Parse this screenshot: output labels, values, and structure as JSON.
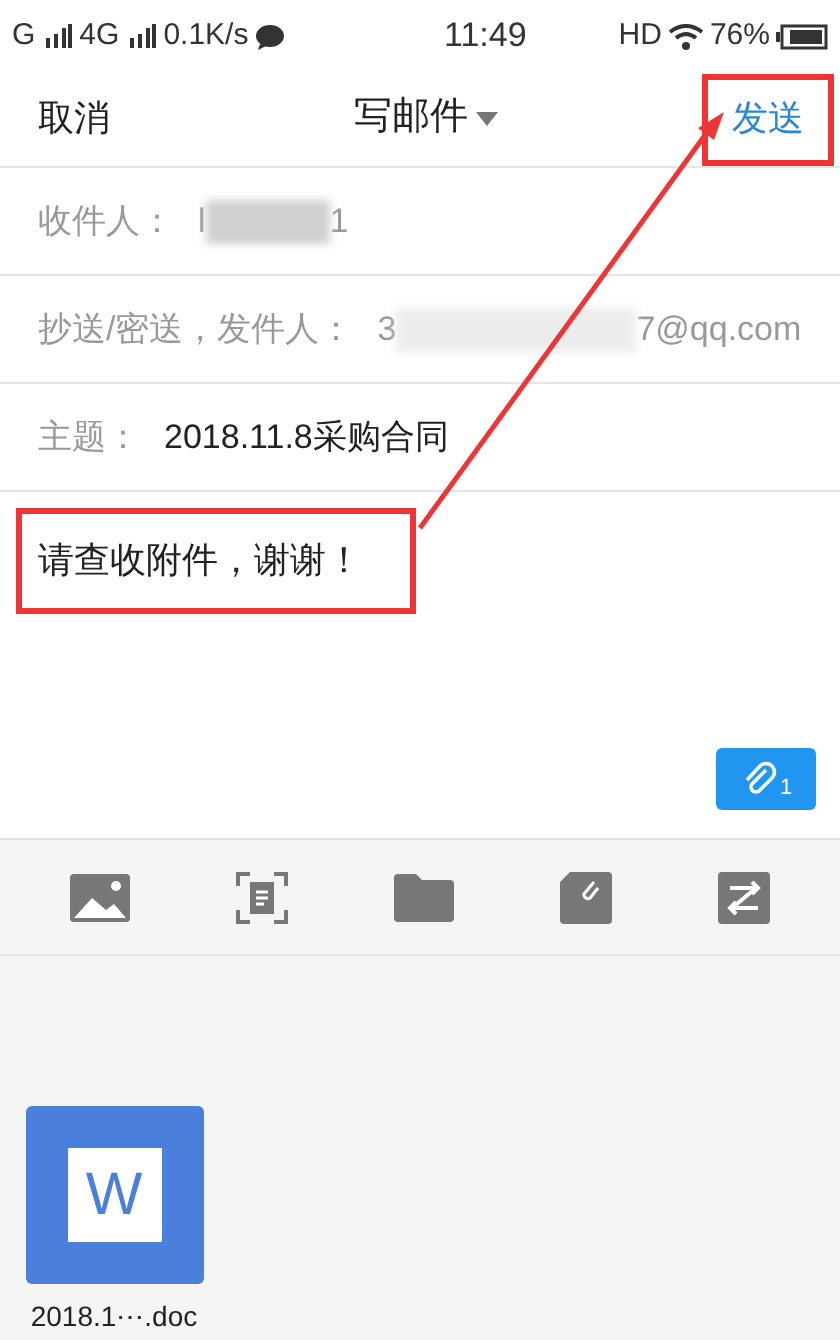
{
  "status_bar": {
    "left": [
      "G",
      "4G",
      "0.1K/s"
    ],
    "time": "11:49",
    "hd": "HD",
    "battery": "76%"
  },
  "header": {
    "cancel": "取消",
    "title": "写邮件",
    "send": "发送"
  },
  "fields": [
    {
      "label": "收件人：",
      "value_start": "l",
      "value_end": "1",
      "blurred": true
    },
    {
      "label": "抄送/密送，发件人：",
      "value_start": "3",
      "value_end": "7@qq.com",
      "blurred": true
    },
    {
      "label": "主题：",
      "value_start": "2018.11.8采购合同",
      "blurred": false
    }
  ],
  "body": "请查收附件，谢谢！",
  "attach_count": "1",
  "attachments": [
    {
      "icon_letter": "W",
      "name": "2018.1⋯.doc"
    }
  ]
}
